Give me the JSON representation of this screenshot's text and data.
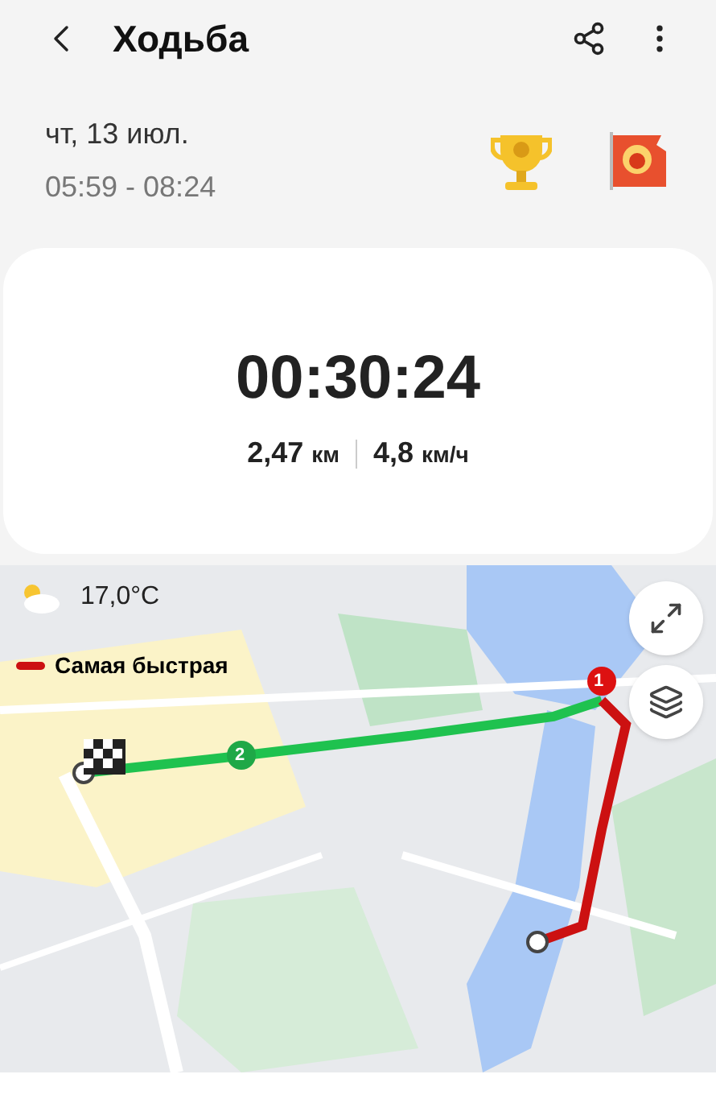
{
  "header": {
    "title": "Ходьба"
  },
  "session": {
    "date": "чт, 13 июл.",
    "time_range": "05:59 - 08:24"
  },
  "summary": {
    "duration": "00:30:24",
    "distance_value": "2,47",
    "distance_unit": "км",
    "speed_value": "4,8",
    "speed_unit": "км/ч"
  },
  "map": {
    "kind": "picture",
    "temperature": "17,0°C",
    "legend": {
      "label": "Самая быстрая",
      "color": "#cc1111"
    },
    "markers": [
      {
        "label": "1",
        "color": "#dd1111"
      },
      {
        "label": "2",
        "color": "#1fa847"
      }
    ]
  }
}
